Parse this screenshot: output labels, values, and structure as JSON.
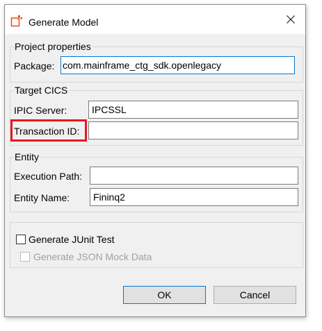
{
  "window": {
    "title": "Generate Model",
    "close_icon": "close-icon",
    "app_icon": "openlegacy-logo-icon"
  },
  "project_properties": {
    "legend": "Project properties",
    "package_label": "Package:",
    "package_value": "com.mainframe_ctg_sdk.openlegacy"
  },
  "target_cics": {
    "legend": "Target CICS",
    "ipic_label": "IPIC Server:",
    "ipic_value": "IPCSSL",
    "transaction_label": "Transaction ID:",
    "transaction_value": ""
  },
  "entity": {
    "legend": "Entity",
    "execution_path_label": "Execution Path:",
    "execution_path_value": "",
    "entity_name_label": "Entity Name:",
    "entity_name_value": "Fininq2"
  },
  "options": {
    "generate_junit_label": "Generate JUnit Test",
    "generate_junit_checked": false,
    "generate_json_mock_label": "Generate JSON Mock Data",
    "generate_json_mock_checked": false,
    "generate_json_mock_enabled": false
  },
  "buttons": {
    "ok_label": "OK",
    "cancel_label": "Cancel"
  },
  "colors": {
    "highlight": "#e8171e",
    "focus": "#0078d7",
    "logo": "#e8561e"
  }
}
